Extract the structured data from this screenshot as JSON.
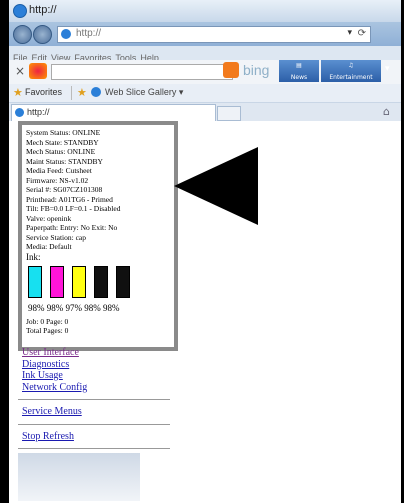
{
  "window": {
    "title": "http://"
  },
  "addressbar": {
    "url": "http://"
  },
  "menubar": {
    "items": [
      "File",
      "Edit",
      "View",
      "Favorites",
      "Tools",
      "Help"
    ]
  },
  "search_toolbar": {
    "brand": "bing",
    "news_label": "News",
    "entertainment_label": "Entertainment"
  },
  "favorites_bar": {
    "favorites_label": "Favorites",
    "web_slice_label": "Web Slice Gallery ▾"
  },
  "tab": {
    "title": "http://"
  },
  "status": {
    "lines": [
      "System Status: ONLINE",
      "Mech State: STANDBY",
      "Mech Status: ONLINE",
      "Maint Status: STANDBY",
      "Media Feed: Cutsheet",
      "Firmware: NS-v1.02",
      "Serial #: SG07CZ101308",
      "Printhead: A01TG6 - Primed",
      "Tilt: FB=0.0 LF=0.1 - Disabled",
      "Valve: openink",
      "Paperpath: Entry: No Exit: No",
      "Service Station: cap",
      "Media: Default"
    ],
    "ink_label": "Ink:",
    "ink_colors": [
      "#17e0f0",
      "#ff14d8",
      "#ffff12",
      "#101010",
      "#101010"
    ],
    "ink_percent_text": "98% 98% 97% 98% 98%",
    "job_line": "Job: 0 Page: 0",
    "total_line": "Total Pages: 0"
  },
  "nav": {
    "user_interface": "User Interface",
    "diagnostics": "Diagnostics",
    "ink_usage": "Ink Usage",
    "network_config": "Network Config",
    "service_menus": "Service Menus",
    "stop_refresh": "Stop Refresh"
  }
}
